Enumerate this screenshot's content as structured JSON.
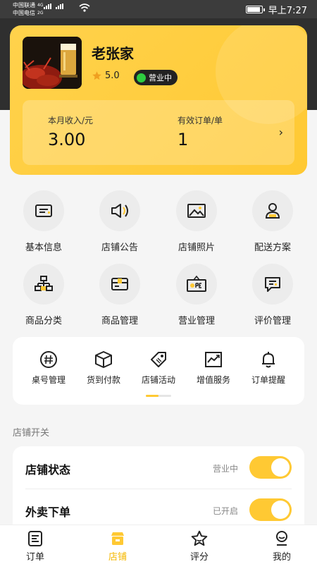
{
  "status_bar": {
    "carrier1": "中国联通",
    "carrier1_net": "4G",
    "carrier2": "中国电信",
    "carrier2_net": "2G",
    "time": "早上7:27"
  },
  "store": {
    "name": "老张家",
    "rating": "5.0",
    "status": "营业中",
    "stats": {
      "income_label": "本月收入/元",
      "income_value": "3.00",
      "orders_label": "有效订单/单",
      "orders_value": "1",
      "arrow": "›"
    }
  },
  "grid": [
    {
      "label": "基本信息",
      "icon": "id-card-icon"
    },
    {
      "label": "店铺公告",
      "icon": "speaker-icon"
    },
    {
      "label": "店铺照片",
      "icon": "image-icon"
    },
    {
      "label": "配送方案",
      "icon": "delivery-person-icon"
    },
    {
      "label": "商品分类",
      "icon": "hierarchy-icon"
    },
    {
      "label": "商品管理",
      "icon": "card-icon"
    },
    {
      "label": "营业管理",
      "icon": "open-sign-icon"
    },
    {
      "label": "评价管理",
      "icon": "comment-icon"
    }
  ],
  "tools": [
    {
      "label": "桌号管理",
      "icon": "hash-icon"
    },
    {
      "label": "货到付款",
      "icon": "box-icon"
    },
    {
      "label": "店铺活动",
      "icon": "tag-icon"
    },
    {
      "label": "增值服务",
      "icon": "chart-icon"
    },
    {
      "label": "订单提醒",
      "icon": "bell-icon"
    }
  ],
  "switches": {
    "section_title": "店铺开关",
    "items": [
      {
        "name": "店铺状态",
        "state": "营业中",
        "on": true
      },
      {
        "name": "外卖下单",
        "state": "已开启",
        "on": true
      }
    ]
  },
  "nav": [
    {
      "label": "订单",
      "icon": "order-icon",
      "active": false
    },
    {
      "label": "店铺",
      "icon": "store-icon",
      "active": true
    },
    {
      "label": "评分",
      "icon": "star-icon",
      "active": false
    },
    {
      "label": "我的",
      "icon": "profile-icon",
      "active": false
    }
  ],
  "colors": {
    "accent": "#ffc933",
    "header_dark": "#2f2f2f",
    "status_green": "#2ecc40"
  }
}
